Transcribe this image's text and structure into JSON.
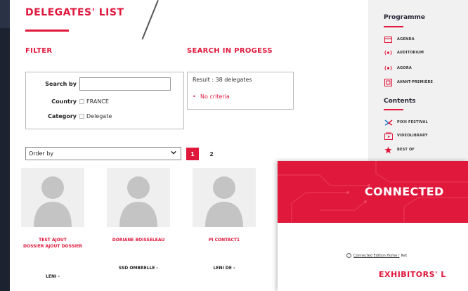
{
  "page": {
    "title": "DELEGATES' LIST"
  },
  "filter": {
    "heading": "FILTER",
    "search_label": "Search by",
    "search_value": "",
    "country_label": "Country",
    "country_value": "FRANCE",
    "category_label": "Category",
    "category_value": "Delegate"
  },
  "search_progress": {
    "heading": "SEARCH IN PROGESS",
    "result": "Result : 38 delegates",
    "criteria": "No criteria"
  },
  "order": {
    "label": "Order by"
  },
  "pagination": {
    "pages": [
      "1",
      "2"
    ],
    "current": "1"
  },
  "delegates": [
    {
      "name_line1": "TEST AJOUT",
      "name_line2": "DOSSIER AJOUT DOSSIER",
      "org": "LENI -"
    },
    {
      "name_line1": "DORIANE BOISSELEAU",
      "name_line2": "",
      "org": "SSD OMBRELLE -"
    },
    {
      "name_line1": "PI CONTACT1",
      "name_line2": "",
      "org": "LENI DE -"
    }
  ],
  "sidebar": {
    "programme_heading": "Programme",
    "programme_items": [
      {
        "label": "AGENDA",
        "icon": "calendar-icon"
      },
      {
        "label": "AUDITORIUM",
        "icon": "broadcast-icon"
      },
      {
        "label": "AGORA",
        "icon": "broadcast-icon"
      },
      {
        "label": "AVANT-PREMIÈRE",
        "icon": "screen-icon"
      }
    ],
    "contents_heading": "Contents",
    "contents_items": [
      {
        "label": "PIXII FESTIVAL",
        "icon": "pixii-icon"
      },
      {
        "label": "VIDEOLIBRARY",
        "icon": "video-library-icon"
      },
      {
        "label": "BEST OF",
        "icon": "star-icon"
      }
    ]
  },
  "overlay": {
    "banner_title": "CONNECTED",
    "breadcrumb_home": "Connected Edition Home /",
    "breadcrumb_next": "Net",
    "section_title": "EXHIBITORS' L"
  },
  "colors": {
    "accent": "#e0183c",
    "sidebar_bg": "#f1f1f1"
  }
}
